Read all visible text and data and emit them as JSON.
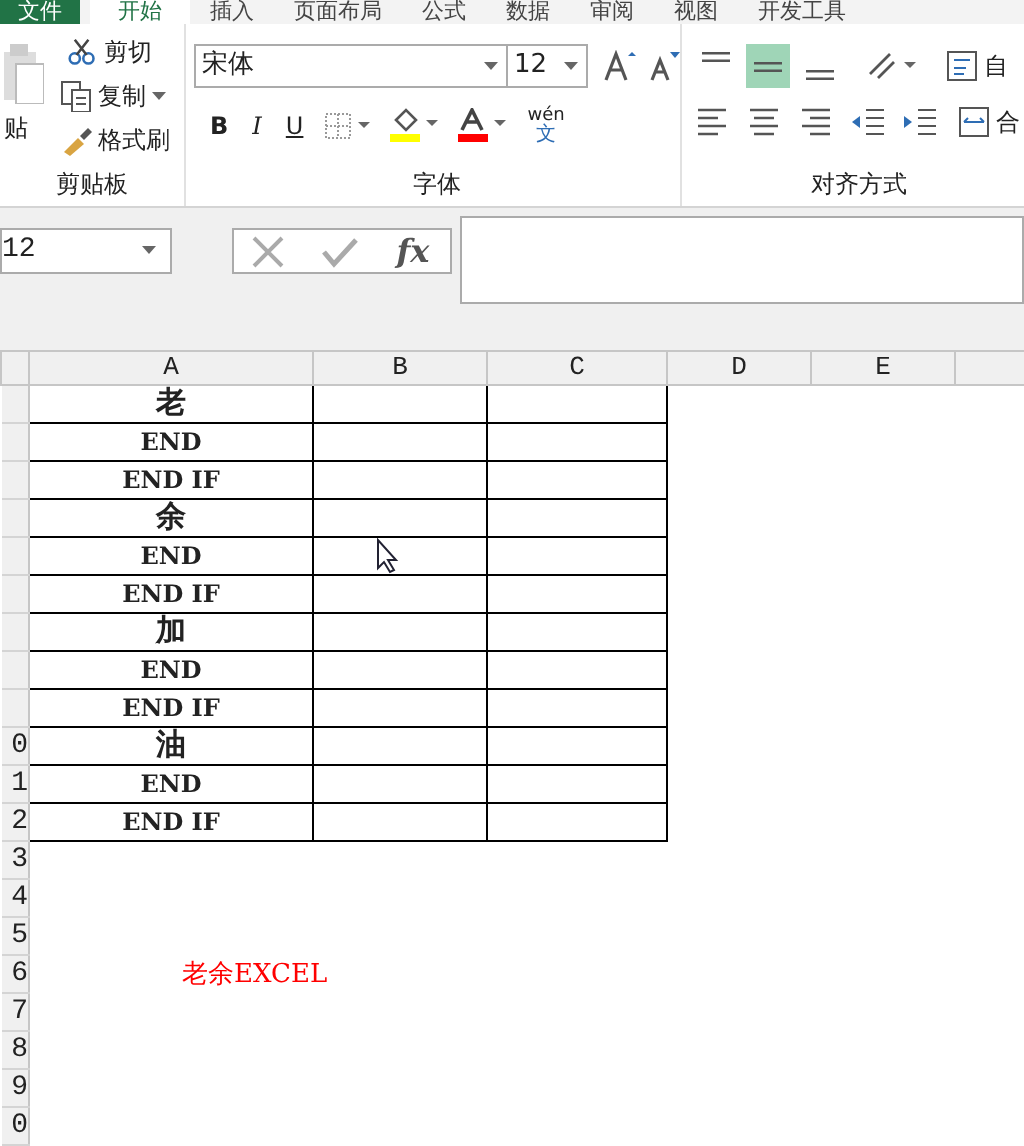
{
  "tabs": [
    {
      "label": "文件",
      "kind": "file",
      "selected": false
    },
    {
      "label": "开始",
      "kind": "tab",
      "selected": true
    },
    {
      "label": "插入",
      "kind": "tab",
      "selected": false
    },
    {
      "label": "页面布局",
      "kind": "tab",
      "selected": false
    },
    {
      "label": "公式",
      "kind": "tab",
      "selected": false
    },
    {
      "label": "数据",
      "kind": "tab",
      "selected": false
    },
    {
      "label": "审阅",
      "kind": "tab",
      "selected": false
    },
    {
      "label": "视图",
      "kind": "tab",
      "selected": false
    },
    {
      "label": "开发工具",
      "kind": "tab",
      "selected": false
    }
  ],
  "clipboard": {
    "label": "剪贴板",
    "paste_label": "贴",
    "commands": [
      {
        "label": "剪切",
        "kind": "cut"
      },
      {
        "label": "复制",
        "kind": "copy"
      },
      {
        "label": "格式刷",
        "kind": "brush"
      }
    ]
  },
  "font": {
    "label": "字体",
    "font_name": "宋体",
    "font_size": "12",
    "styles": [
      {
        "label": "B",
        "kind": "bold"
      },
      {
        "label": "I",
        "kind": "italic"
      },
      {
        "label": "U",
        "kind": "underline"
      }
    ],
    "phonetic_top": "wén",
    "phonetic_char": "文"
  },
  "alignment": {
    "label": "对齐方式",
    "vertical": [
      {
        "kind": "top",
        "selected": false
      },
      {
        "kind": "middle",
        "selected": true
      },
      {
        "kind": "bottom",
        "selected": false
      }
    ],
    "wrap_label": "自",
    "merge_label": "合"
  },
  "formula_bar": {
    "name_box": "12",
    "function_label": "fx"
  },
  "sheet": {
    "columns": [
      "A",
      "B",
      "C",
      "D",
      "E"
    ],
    "rows": [
      {
        "a": "老",
        "kind": "char"
      },
      {
        "a": "END",
        "kind": "code"
      },
      {
        "a": "END IF",
        "kind": "code"
      },
      {
        "a": "余",
        "kind": "char"
      },
      {
        "a": "END",
        "kind": "code"
      },
      {
        "a": "END IF",
        "kind": "code"
      },
      {
        "a": "加",
        "kind": "char"
      },
      {
        "a": "END",
        "kind": "code"
      },
      {
        "a": "END IF",
        "kind": "code"
      },
      {
        "header": "0",
        "a": "油",
        "kind": "char"
      },
      {
        "header": "1",
        "a": "END",
        "kind": "code"
      },
      {
        "header": "2",
        "a": "END IF",
        "kind": "code"
      },
      {
        "header": "3",
        "kind": "blank"
      },
      {
        "header": "4",
        "kind": "blank"
      },
      {
        "header": "5",
        "kind": "blank"
      },
      {
        "header": "6",
        "a": "老余EXCEL",
        "kind": "note"
      },
      {
        "header": "7",
        "kind": "blank"
      },
      {
        "header": "8",
        "kind": "blank"
      },
      {
        "header": "9",
        "kind": "blank"
      },
      {
        "header": "0",
        "kind": "blank"
      }
    ]
  }
}
